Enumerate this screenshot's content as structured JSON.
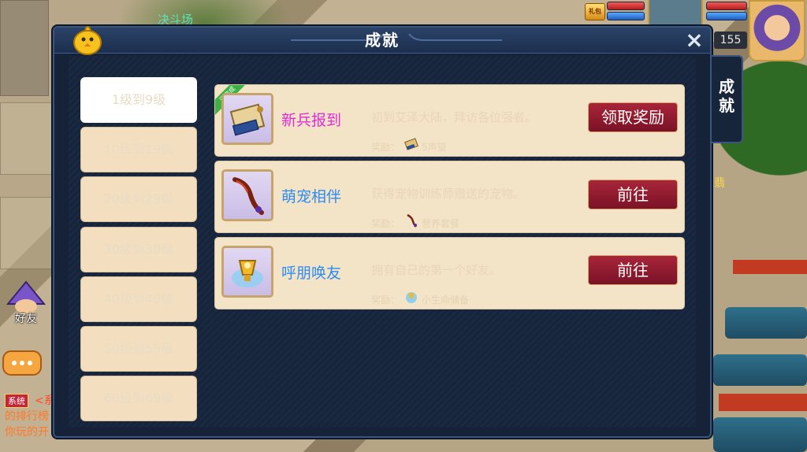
{
  "colors": {
    "panel_bg": "#152238",
    "card_bg": "#f3e3c7",
    "button_red": "#8e1a2f",
    "name_magenta": "#e22bd6",
    "name_blue": "#2b8cf2"
  },
  "background": {
    "arena_label": "决斗场",
    "gift_badge": "礼包",
    "side_fragment": "翡",
    "system_tag": "系统",
    "system_line1": "<系",
    "system_line2": "的排行榜",
    "system_line3": "你玩的开"
  },
  "hud": {
    "level": "155"
  },
  "panel": {
    "title": "成就",
    "close_icon": "×",
    "side_tab": "成就"
  },
  "categories": [
    {
      "label": "1级到9级",
      "active": true
    },
    {
      "label": "10级到19级",
      "active": false
    },
    {
      "label": "20级到29级",
      "active": false
    },
    {
      "label": "30级到39级",
      "active": false
    },
    {
      "label": "40级到49级",
      "active": false
    },
    {
      "label": "50级到59级",
      "active": false
    },
    {
      "label": "60级到69级",
      "active": false
    }
  ],
  "achievements": [
    {
      "badge": "已完成",
      "name": "新兵报到",
      "name_color": "#e22bd6",
      "icon": "scroll-map-icon",
      "description": "初到艾泽大陆，拜访各位强者。",
      "reward_label": "奖励：",
      "reward_icon": "fame-scroll-icon",
      "reward": "5声望",
      "button": "领取奖励"
    },
    {
      "name": "萌宠相伴",
      "name_color": "#2b8cf2",
      "icon": "bone-staff-icon",
      "description": "获得宠物训练师赠送的宠物。",
      "reward_label": "奖励：",
      "reward_icon": "pet-food-icon",
      "reward": "营养套餐",
      "button": "前往"
    },
    {
      "name": "呼朋唤友",
      "name_color": "#2b8cf2",
      "icon": "golden-trophy-icon",
      "description": "拥有自己的第一个好友。",
      "reward_label": "奖励：",
      "reward_icon": "life-storage-icon",
      "reward": "小生命储备",
      "button": "前往"
    }
  ],
  "left_ui": {
    "friend_label": "好友"
  }
}
